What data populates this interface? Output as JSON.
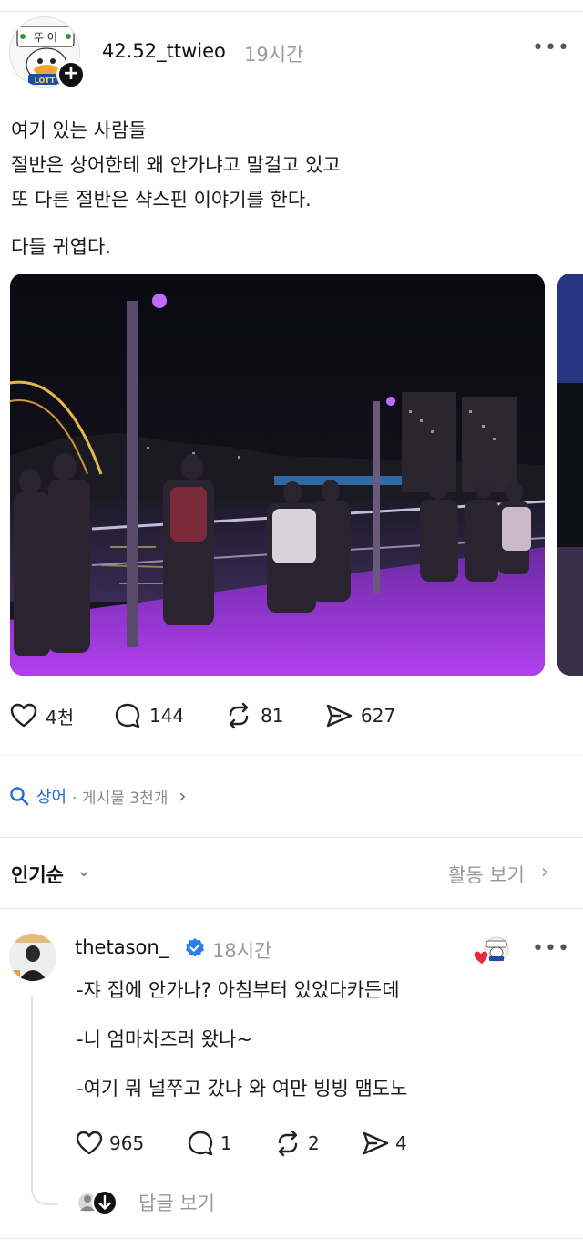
{
  "post": {
    "username": "42.52_ttwieo",
    "time": "19시간",
    "avatar_text": "뚜 어",
    "avatar_badge": "LOTT",
    "follow_symbol": "+",
    "more_symbol": "•••",
    "lines": [
      "여기 있는 사람들",
      "절반은 상어한테 왜 안가냐고 말걸고 있고",
      "또 다른 절반은 샥스핀 이야기를 한다.",
      "다들 귀엽다."
    ],
    "likes": "4천",
    "comments": "144",
    "reposts": "81",
    "shares": "627",
    "icons": {
      "like": "heart-icon",
      "comment": "comment-icon",
      "repost": "repost-icon",
      "share": "share-icon"
    }
  },
  "topic": {
    "tag": "상어",
    "meta": "· 게시물 3천개",
    "chevron": "›"
  },
  "sort": {
    "label": "인기순",
    "chevron": "⌄",
    "activity": "활동 보기",
    "activity_chevron": "›"
  },
  "reply": {
    "username": "thetason_",
    "time": "18시간",
    "more_symbol": "•••",
    "lines": [
      "-쟈 집에 안가나? 아침부터 있었다카든데",
      "-니 엄마차즈러 왔나~",
      "-여기 뭐 널쭈고 갔나 와 여만 빙빙 맴도노"
    ],
    "likes": "965",
    "comments": "1",
    "reposts": "2",
    "shares": "4",
    "view_replies": "답글 보기"
  },
  "colors": {
    "accent_blue": "#1d6ed8",
    "verified_blue": "#2b7de9",
    "like_red": "#e8273b",
    "muted": "#9a9a9a"
  }
}
